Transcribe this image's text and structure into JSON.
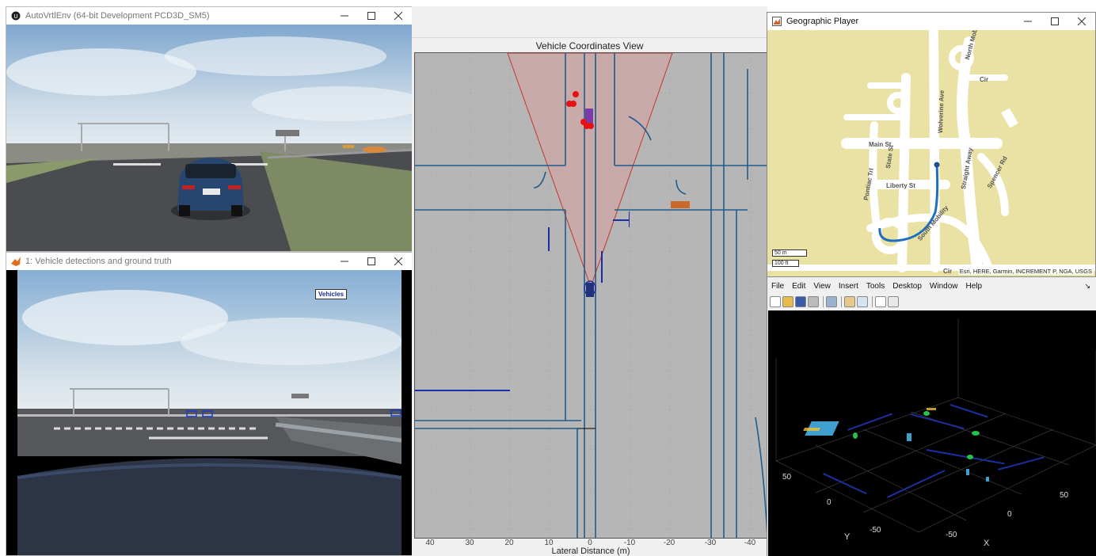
{
  "windows": {
    "sim": {
      "title": "AutoVrtlEnv (64-bit Development PCD3D_SM5)"
    },
    "detections": {
      "title": "1: Vehicle detections and ground truth",
      "badge": "Vehicles"
    },
    "vehicle_view": {
      "title": "Vehicle Coordinates View",
      "xlabel": "Lateral Distance (m)",
      "xticks": [
        "40",
        "30",
        "20",
        "10",
        "0",
        "-10",
        "-20",
        "-30",
        "-40"
      ]
    },
    "geo": {
      "title": "Geographic Player",
      "streets": [
        "Main St",
        "Liberty St",
        "State St",
        "Pontiac Trl",
        "Wolverine Ave",
        "Straight Away",
        "Spencer Rd",
        "South Mobility",
        "North Mobility",
        "Cir",
        "Cir"
      ],
      "scale_m": "50 m",
      "scale_ft": "100 ft",
      "attribution": "Esri, HERE, Garmin, INCREMENT P, NGA, USGS"
    },
    "figure": {
      "menu": [
        "File",
        "Edit",
        "View",
        "Insert",
        "Tools",
        "Desktop",
        "Window",
        "Help"
      ],
      "toolbar_icons": [
        "new-file-icon",
        "open-icon",
        "save-icon",
        "print-icon",
        "print-preview-icon",
        "insert-colorbar-icon",
        "insert-legend-icon",
        "pointer-icon",
        "property-inspector-icon"
      ],
      "pointcloud": {
        "ticks": [
          "50",
          "0",
          "-50",
          "50",
          "0",
          "-50"
        ],
        "xlabel": "X",
        "ylabel": "Y"
      }
    }
  },
  "colors": {
    "coverage": "#d9a1a1",
    "lane": "#1f5d8c",
    "detection": "#e81010",
    "map_bg": "#e9e2a4",
    "route": "#1e6fbf"
  }
}
